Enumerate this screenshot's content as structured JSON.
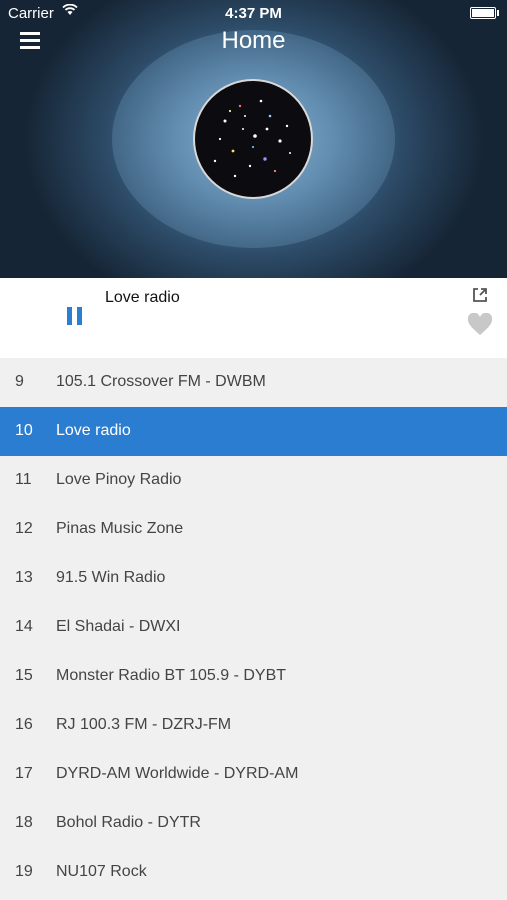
{
  "status_bar": {
    "carrier": "Carrier",
    "time": "4:37 PM"
  },
  "header": {
    "title": "Home"
  },
  "player": {
    "now_playing": "Love radio",
    "state_icon": "pause-icon"
  },
  "stations": [
    {
      "number": "9",
      "name": "105.1 Crossover FM - DWBM",
      "active": false
    },
    {
      "number": "10",
      "name": "Love radio",
      "active": true
    },
    {
      "number": "11",
      "name": "Love Pinoy Radio",
      "active": false
    },
    {
      "number": "12",
      "name": "Pinas Music Zone",
      "active": false
    },
    {
      "number": "13",
      "name": "91.5 Win Radio",
      "active": false
    },
    {
      "number": "14",
      "name": "El Shadai - DWXI",
      "active": false
    },
    {
      "number": "15",
      "name": "Monster Radio BT 105.9 - DYBT",
      "active": false
    },
    {
      "number": "16",
      "name": "RJ 100.3 FM - DZRJ-FM",
      "active": false
    },
    {
      "number": "17",
      "name": "DYRD-AM Worldwide - DYRD-AM",
      "active": false
    },
    {
      "number": "18",
      "name": "Bohol Radio - DYTR",
      "active": false
    },
    {
      "number": "19",
      "name": "NU107 Rock",
      "active": false
    }
  ],
  "colors": {
    "accent": "#2b7dd2",
    "list_bg": "#f0f0f0",
    "heart": "#c8c8c8"
  }
}
